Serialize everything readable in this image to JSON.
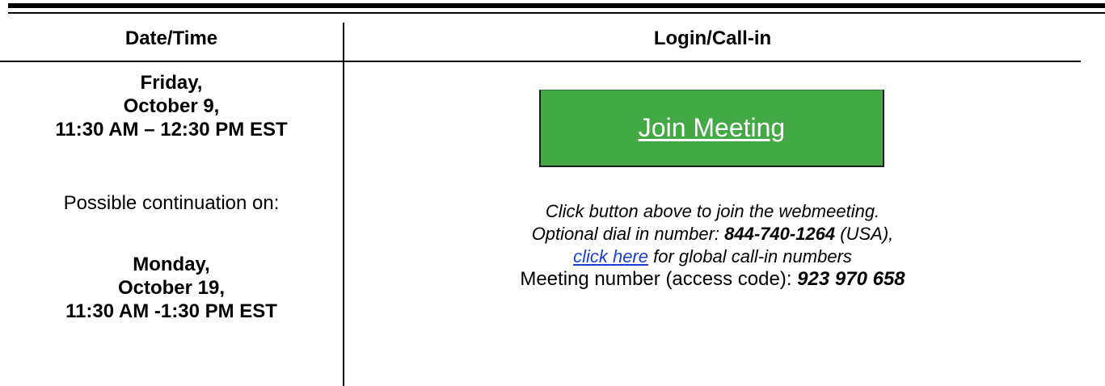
{
  "table": {
    "headers": {
      "date_time": "Date/Time",
      "login_callin": "Login/Call-in"
    },
    "primary_session": {
      "day": "Friday,",
      "date": "October 9,",
      "time": "11:30 AM – 12:30 PM EST"
    },
    "continuation_label": "Possible continuation on:",
    "continuation_session": {
      "day": "Monday,",
      "date": "October 19,",
      "time": "11:30 AM -1:30 PM EST"
    }
  },
  "join_button": {
    "label": "Join Meeting",
    "color": "#43a945"
  },
  "call_info": {
    "instruction": "Click button above to join the webmeeting.",
    "dial_prefix": "Optional dial in number: ",
    "dial_number": "844-740-1264",
    "dial_suffix": " (USA),",
    "global_link": "click here",
    "global_suffix": " for global call-in numbers",
    "meeting_label": "Meeting number (access code): ",
    "meeting_code": "923 970 658",
    "link_color": "#1a3fd6"
  }
}
